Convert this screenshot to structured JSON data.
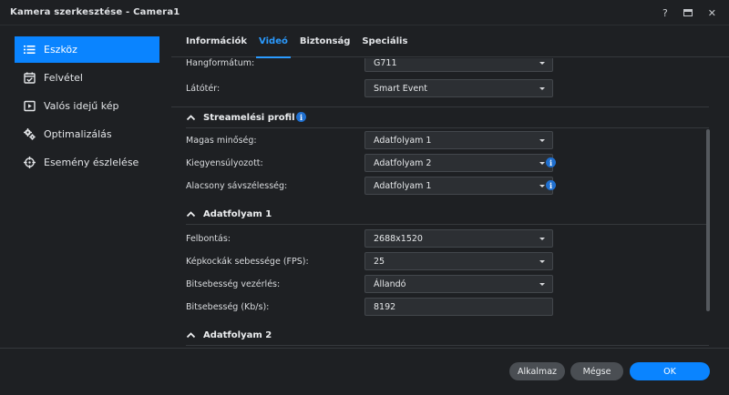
{
  "window": {
    "title": "Kamera szerkesztése - Camera1",
    "help_label": "?",
    "close_label": "✕"
  },
  "sidebar": {
    "items": [
      {
        "label": "Eszköz",
        "icon": "list-icon",
        "active": true
      },
      {
        "label": "Felvétel",
        "icon": "calendar-check-icon",
        "active": false
      },
      {
        "label": "Valós idejű kép",
        "icon": "play-box-icon",
        "active": false
      },
      {
        "label": "Optimalizálás",
        "icon": "gears-icon",
        "active": false
      },
      {
        "label": "Esemény észlelése",
        "icon": "crosshair-icon",
        "active": false
      }
    ]
  },
  "tabs": [
    {
      "label": "Információk",
      "active": false
    },
    {
      "label": "Videó",
      "active": true
    },
    {
      "label": "Biztonság",
      "active": false
    },
    {
      "label": "Speciális",
      "active": false
    }
  ],
  "content": {
    "partial_row": {
      "label": "Hangformátum:",
      "value": "G711"
    },
    "fov": {
      "label": "Látótér:",
      "value": "Smart Event"
    },
    "stream_profile": {
      "title": "Streamelési profil",
      "rows": [
        {
          "label": "Magas minőség:",
          "value": "Adatfolyam 1"
        },
        {
          "label": "Kiegyensúlyozott:",
          "value": "Adatfolyam 2"
        },
        {
          "label": "Alacsony sávszélesség:",
          "value": "Adatfolyam 1"
        }
      ]
    },
    "stream1": {
      "title": "Adatfolyam 1",
      "rows": [
        {
          "label": "Felbontás:",
          "value": "2688x1520",
          "type": "select"
        },
        {
          "label": "Képkockák sebessége (FPS):",
          "value": "25",
          "type": "select"
        },
        {
          "label": "Bitsebesség vezérlés:",
          "value": "Állandó",
          "type": "select"
        },
        {
          "label": "Bitsebesség (Kb/s):",
          "value": "8192",
          "type": "input"
        }
      ]
    },
    "stream2": {
      "title": "Adatfolyam 2"
    }
  },
  "footer": {
    "apply_label": "Alkalmaz",
    "cancel_label": "Mégse",
    "ok_label": "OK"
  },
  "colors": {
    "accent": "#0a84ff",
    "background": "#1e2023",
    "field_bg": "#2c2f33",
    "info_icon": "#1f6fcf"
  }
}
